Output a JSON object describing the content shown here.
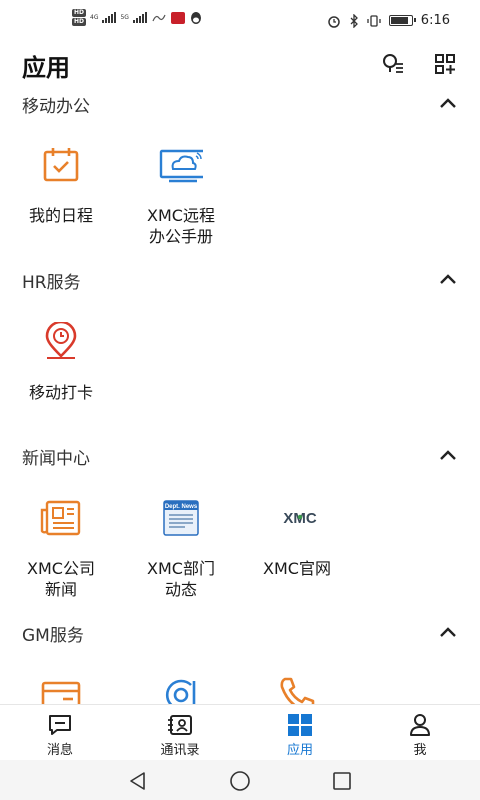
{
  "status_bar": {
    "hd1": "HD",
    "hd2": "HD",
    "net1": "4G",
    "net2": "5G",
    "time": "6:16",
    "battery_level": 0.85
  },
  "header": {
    "title": "应用",
    "icons": [
      "search-person-icon",
      "add-app-icon"
    ]
  },
  "sections": [
    {
      "title": "移动办公",
      "apps": [
        {
          "label": "我的日程",
          "icon": "calendar-check-icon"
        },
        {
          "label": "XMC远程\n办公手册",
          "icon": "remote-monitor-icon"
        }
      ]
    },
    {
      "title": "HR服务",
      "apps": [
        {
          "label": "移动打卡",
          "icon": "location-clock-icon"
        }
      ]
    },
    {
      "title": "新闻中心",
      "apps": [
        {
          "label": "XMC公司\n新闻",
          "icon": "newspaper-icon"
        },
        {
          "label": "XMC部门\n动态",
          "icon": "dept-news-icon",
          "badge_text": "Dept. News"
        },
        {
          "label": "XMC官网",
          "icon": "xmc-logo-icon",
          "logo_text": "XMC"
        }
      ]
    },
    {
      "title": "GM服务",
      "apps": [
        {
          "label": "",
          "icon": "card-icon"
        },
        {
          "label": "",
          "icon": "at-sign-icon"
        },
        {
          "label": "",
          "icon": "phone-icon"
        }
      ]
    }
  ],
  "tabs": [
    {
      "label": "消息",
      "icon": "message-icon",
      "active": false
    },
    {
      "label": "通讯录",
      "icon": "contacts-icon",
      "active": false
    },
    {
      "label": "应用",
      "icon": "apps-grid-icon",
      "active": true
    },
    {
      "label": "我",
      "icon": "profile-icon",
      "active": false
    }
  ],
  "colors": {
    "accent": "#1677d2",
    "orange": "#e8802a",
    "red": "#d93a2b",
    "blue": "#2a7fd4"
  }
}
